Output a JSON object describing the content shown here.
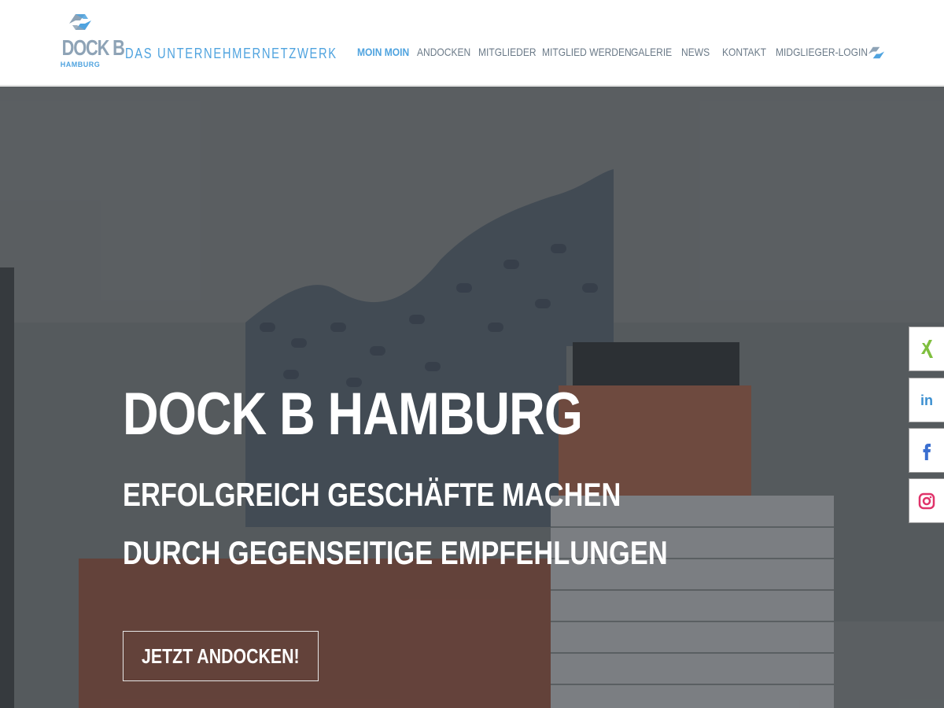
{
  "header": {
    "logo": {
      "title": "DOCK B",
      "subtitle": "HAMBURG"
    },
    "tagline": "DAS UNTERNEHMERNETZWERK",
    "nav": [
      {
        "label": "MOIN MOIN",
        "active": true
      },
      {
        "label": "ANDOCKEN",
        "active": false
      },
      {
        "label": "MITGLIEDER",
        "active": false
      },
      {
        "label": "MITGLIED WERDEN",
        "active": false
      },
      {
        "label": "GALERIE",
        "active": false
      },
      {
        "label": "NEWS",
        "active": false
      },
      {
        "label": "KONTAKT",
        "active": false
      },
      {
        "label": "MIDGLIEGER-LOGIN",
        "active": false
      }
    ],
    "nav_icon": "dock-b-logo-icon"
  },
  "hero": {
    "title": "DOCK B HAMBURG",
    "line1": "ERFOLGREICH GESCHÄFTE MACHEN",
    "line2": "DURCH GEGENSEITIGE EMPFEHLUNGEN",
    "cta_label": "JETZT ANDOCKEN!",
    "background": "elbphilharmonie-photo"
  },
  "social": [
    {
      "name": "xing",
      "icon": "xing-icon",
      "color": "#7fbf3f"
    },
    {
      "name": "linkedin",
      "icon": "linkedin-icon",
      "color": "#3b8fd0"
    },
    {
      "name": "facebook",
      "icon": "facebook-icon",
      "color": "#3b6fd0"
    },
    {
      "name": "instagram",
      "icon": "instagram-icon",
      "color": "#e0336a"
    }
  ],
  "colors": {
    "accent": "#4fa3df",
    "logo_grey": "#8ea3b6",
    "nav_text": "#6b7a88"
  }
}
